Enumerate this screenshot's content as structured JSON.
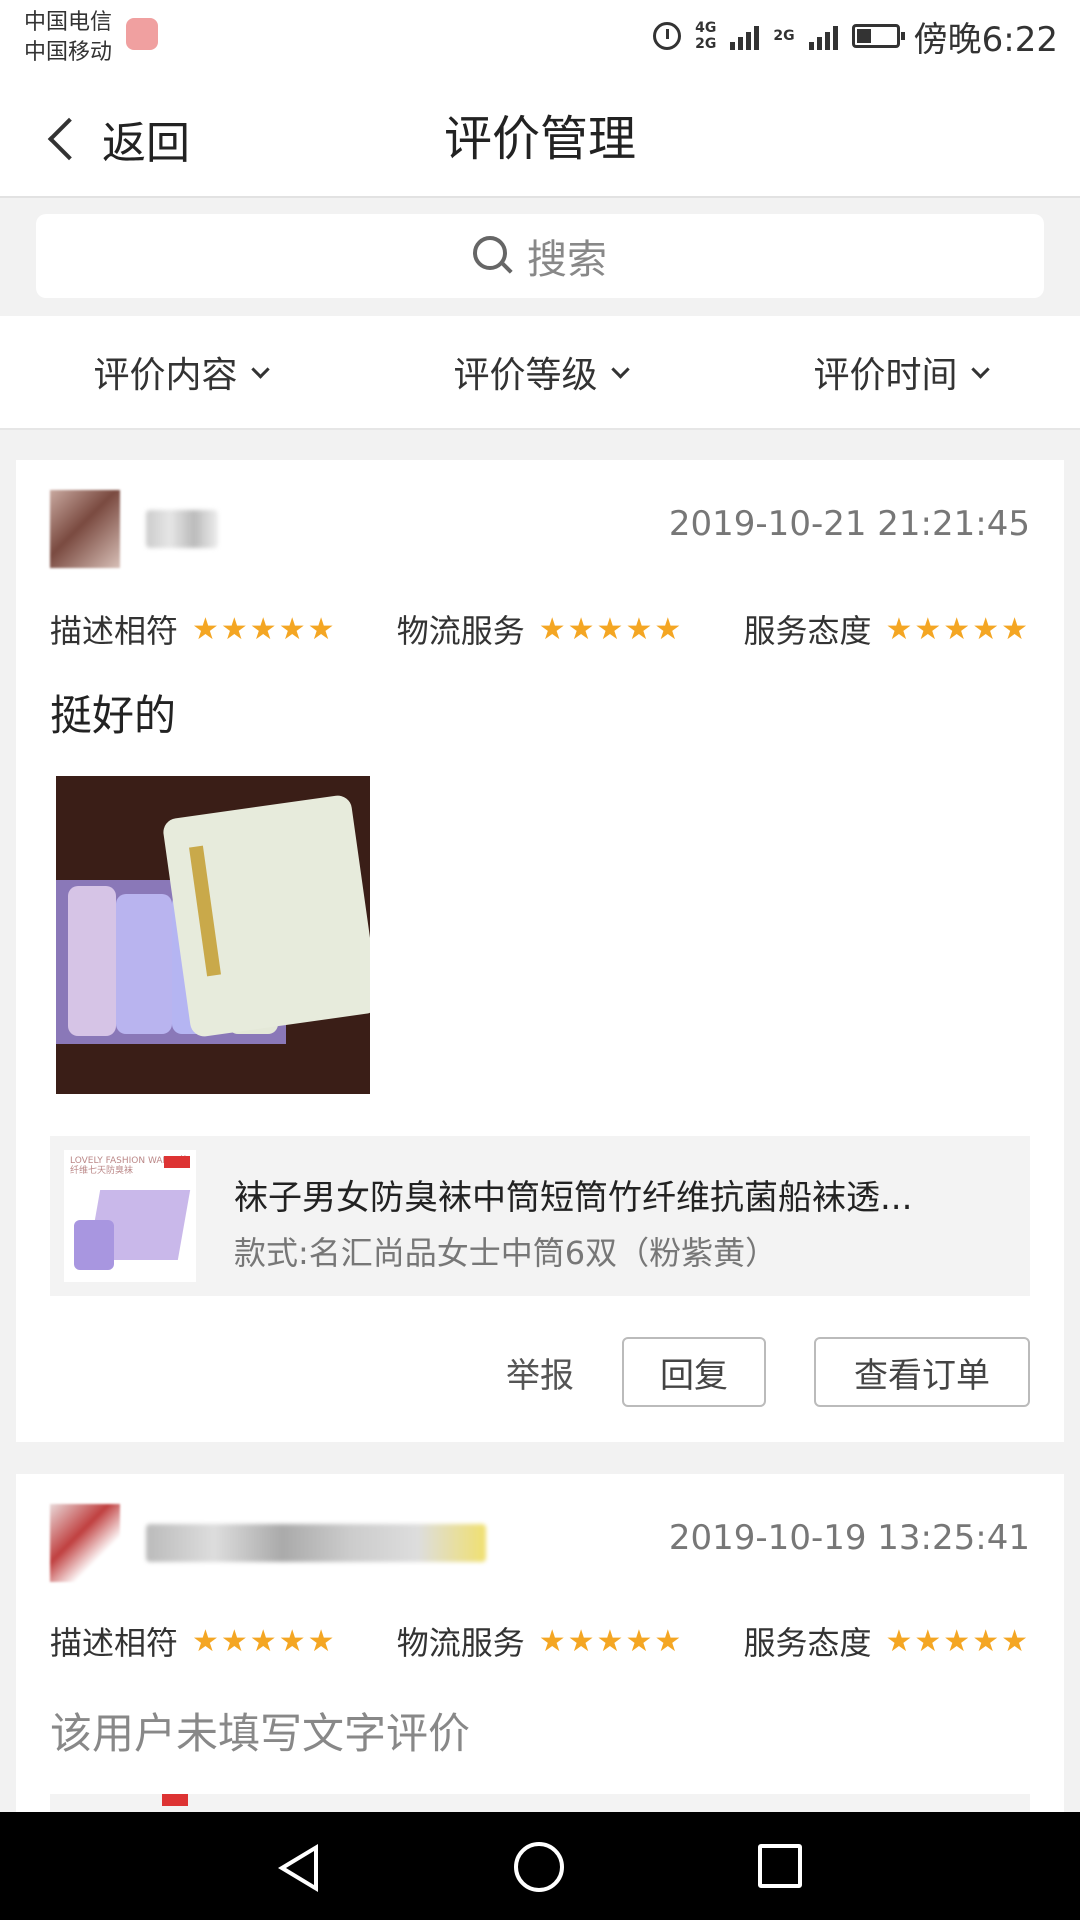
{
  "status_bar": {
    "carrier_1": "中国电信",
    "carrier_2": "中国移动",
    "network_1": "4G",
    "network_2": "2G",
    "network_3": "2G",
    "time": "傍晚6:22"
  },
  "nav": {
    "back_label": "返回",
    "title": "评价管理"
  },
  "search": {
    "placeholder": "搜索"
  },
  "filters": [
    {
      "label": "评价内容"
    },
    {
      "label": "评价等级"
    },
    {
      "label": "评价时间"
    }
  ],
  "reviews": [
    {
      "time": "2019-10-21 21:21:45",
      "ratings": [
        {
          "label": "描述相符",
          "stars": "★★★★★",
          "value": 5
        },
        {
          "label": "物流服务",
          "stars": "★★★★★",
          "value": 5
        },
        {
          "label": "服务态度",
          "stars": "★★★★★",
          "value": 5
        }
      ],
      "comment": "挺好的",
      "product": {
        "title": "袜子男女防臭袜中筒短筒竹纤维抗菌船袜透...",
        "spec": "款式:名汇尚品女士中筒6双（粉紫黄）",
        "thumb_text": "LOVELY FASHION WARM 竹纤维七天防臭袜"
      },
      "actions": {
        "report": "举报",
        "reply": "回复",
        "view_order": "查看订单"
      }
    },
    {
      "time": "2019-10-19 13:25:41",
      "ratings": [
        {
          "label": "描述相符",
          "stars": "★★★★★",
          "value": 5
        },
        {
          "label": "物流服务",
          "stars": "★★★★★",
          "value": 5
        },
        {
          "label": "服务态度",
          "stars": "★★★★★",
          "value": 5
        }
      ],
      "comment": "该用户未填写文字评价"
    }
  ],
  "colors": {
    "star": "#f4a623",
    "background": "#f2f2f2"
  },
  "icons": [
    "back-chevron-icon",
    "search-icon",
    "chevron-down-icon",
    "alarm-icon",
    "battery-icon",
    "nav-back-icon",
    "nav-home-icon",
    "nav-recents-icon"
  ]
}
